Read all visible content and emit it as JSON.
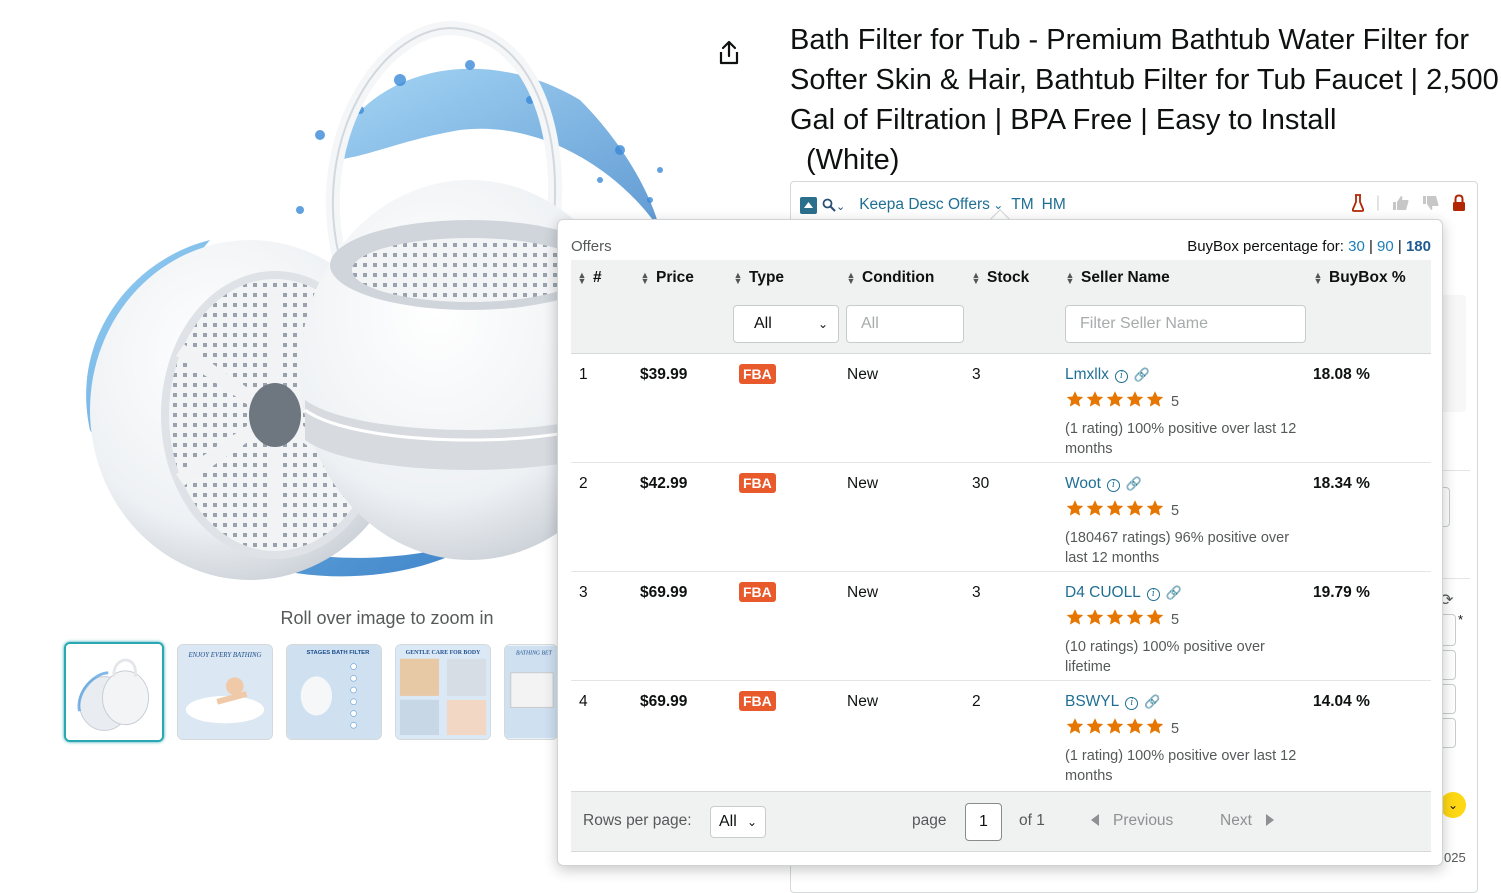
{
  "product": {
    "title_line": "Bath Filter for Tub - Premium Bathtub Water Filter for Softer Skin & Hair, Bathtub Filter for Tub Faucet | 2,500 Gal of Filtration | BPA Free | Easy to Install",
    "variant": "(White)",
    "zoom_hint": "Roll over image to zoom in",
    "thumbnail_captions": [
      "",
      "ENJOY EVERY BATHING",
      "STAGES BATH FILTER",
      "GENTLE CARE FOR BODY",
      "BATHING BET"
    ]
  },
  "keepa_bar": {
    "label": "Keepa Desc Offers",
    "tm": "TM",
    "hm": "HM"
  },
  "offers_popup": {
    "heading": "Offers",
    "buybox_label": "BuyBox percentage for:",
    "buybox_periods": [
      "30",
      "90",
      "180"
    ],
    "selected_period": "180",
    "columns": [
      "#",
      "Price",
      "Type",
      "Condition",
      "Stock",
      "Seller Name",
      "BuyBox %"
    ],
    "filters": {
      "type_value": "All",
      "condition_placeholder": "All",
      "seller_placeholder": "Filter Seller Name"
    },
    "rows": [
      {
        "num": "1",
        "price": "$39.99",
        "type": "FBA",
        "condition": "New",
        "stock": "3",
        "seller": "Lmxllx",
        "stars": "5",
        "rating_text": "(1 rating) 100% positive over last 12 months",
        "buybox": "18.08 %"
      },
      {
        "num": "2",
        "price": "$42.99",
        "type": "FBA",
        "condition": "New",
        "stock": "30",
        "seller": "Woot",
        "stars": "5",
        "rating_text": "(180467 ratings) 96% positive over last 12 months",
        "buybox": "18.34 %"
      },
      {
        "num": "3",
        "price": "$69.99",
        "type": "FBA",
        "condition": "New",
        "stock": "3",
        "seller": "D4 CUOLL",
        "stars": "5",
        "rating_text": "(10 ratings) 100% positive over lifetime",
        "buybox": "19.79 %"
      },
      {
        "num": "4",
        "price": "$69.99",
        "type": "FBA",
        "condition": "New",
        "stock": "2",
        "seller": "BSWYL",
        "stars": "5",
        "rating_text": "(1 rating) 100% positive over last 12 months",
        "buybox": "14.04 %"
      }
    ],
    "footer": {
      "rows_per_page_label": "Rows per page:",
      "rows_per_page_value": "All",
      "page_label": "page",
      "page_value": "1",
      "of_label": "of 1",
      "previous": "Previous",
      "next": "Next"
    }
  },
  "background_fragments": {
    "year_suffix": "025"
  },
  "colors": {
    "link": "#1f6f94",
    "fba_badge": "#e8592c",
    "star": "#e77600",
    "accent": "#2aa7b1"
  }
}
